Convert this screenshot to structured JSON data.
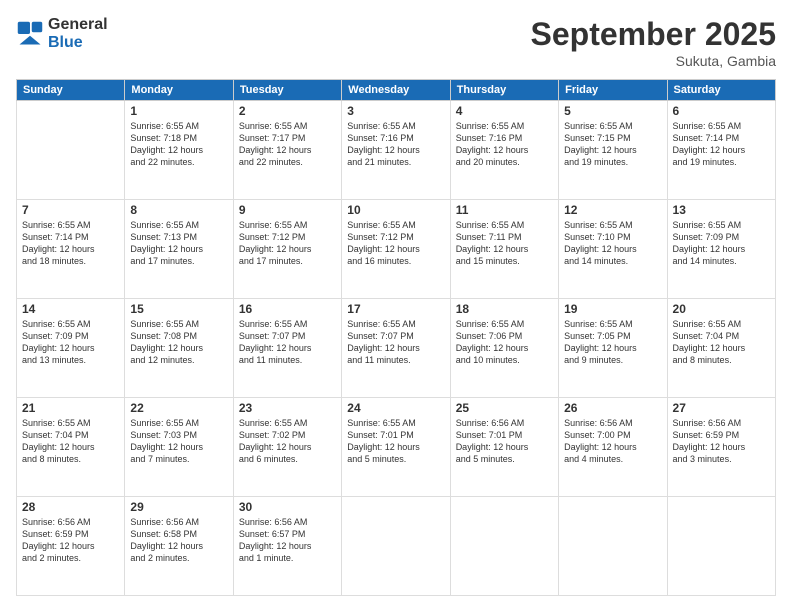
{
  "header": {
    "logo_line1": "General",
    "logo_line2": "Blue",
    "month": "September 2025",
    "location": "Sukuta, Gambia"
  },
  "days_of_week": [
    "Sunday",
    "Monday",
    "Tuesday",
    "Wednesday",
    "Thursday",
    "Friday",
    "Saturday"
  ],
  "weeks": [
    [
      {
        "day": "",
        "info": ""
      },
      {
        "day": "1",
        "info": "Sunrise: 6:55 AM\nSunset: 7:18 PM\nDaylight: 12 hours\nand 22 minutes."
      },
      {
        "day": "2",
        "info": "Sunrise: 6:55 AM\nSunset: 7:17 PM\nDaylight: 12 hours\nand 22 minutes."
      },
      {
        "day": "3",
        "info": "Sunrise: 6:55 AM\nSunset: 7:16 PM\nDaylight: 12 hours\nand 21 minutes."
      },
      {
        "day": "4",
        "info": "Sunrise: 6:55 AM\nSunset: 7:16 PM\nDaylight: 12 hours\nand 20 minutes."
      },
      {
        "day": "5",
        "info": "Sunrise: 6:55 AM\nSunset: 7:15 PM\nDaylight: 12 hours\nand 19 minutes."
      },
      {
        "day": "6",
        "info": "Sunrise: 6:55 AM\nSunset: 7:14 PM\nDaylight: 12 hours\nand 19 minutes."
      }
    ],
    [
      {
        "day": "7",
        "info": "Sunrise: 6:55 AM\nSunset: 7:14 PM\nDaylight: 12 hours\nand 18 minutes."
      },
      {
        "day": "8",
        "info": "Sunrise: 6:55 AM\nSunset: 7:13 PM\nDaylight: 12 hours\nand 17 minutes."
      },
      {
        "day": "9",
        "info": "Sunrise: 6:55 AM\nSunset: 7:12 PM\nDaylight: 12 hours\nand 17 minutes."
      },
      {
        "day": "10",
        "info": "Sunrise: 6:55 AM\nSunset: 7:12 PM\nDaylight: 12 hours\nand 16 minutes."
      },
      {
        "day": "11",
        "info": "Sunrise: 6:55 AM\nSunset: 7:11 PM\nDaylight: 12 hours\nand 15 minutes."
      },
      {
        "day": "12",
        "info": "Sunrise: 6:55 AM\nSunset: 7:10 PM\nDaylight: 12 hours\nand 14 minutes."
      },
      {
        "day": "13",
        "info": "Sunrise: 6:55 AM\nSunset: 7:09 PM\nDaylight: 12 hours\nand 14 minutes."
      }
    ],
    [
      {
        "day": "14",
        "info": "Sunrise: 6:55 AM\nSunset: 7:09 PM\nDaylight: 12 hours\nand 13 minutes."
      },
      {
        "day": "15",
        "info": "Sunrise: 6:55 AM\nSunset: 7:08 PM\nDaylight: 12 hours\nand 12 minutes."
      },
      {
        "day": "16",
        "info": "Sunrise: 6:55 AM\nSunset: 7:07 PM\nDaylight: 12 hours\nand 11 minutes."
      },
      {
        "day": "17",
        "info": "Sunrise: 6:55 AM\nSunset: 7:07 PM\nDaylight: 12 hours\nand 11 minutes."
      },
      {
        "day": "18",
        "info": "Sunrise: 6:55 AM\nSunset: 7:06 PM\nDaylight: 12 hours\nand 10 minutes."
      },
      {
        "day": "19",
        "info": "Sunrise: 6:55 AM\nSunset: 7:05 PM\nDaylight: 12 hours\nand 9 minutes."
      },
      {
        "day": "20",
        "info": "Sunrise: 6:55 AM\nSunset: 7:04 PM\nDaylight: 12 hours\nand 8 minutes."
      }
    ],
    [
      {
        "day": "21",
        "info": "Sunrise: 6:55 AM\nSunset: 7:04 PM\nDaylight: 12 hours\nand 8 minutes."
      },
      {
        "day": "22",
        "info": "Sunrise: 6:55 AM\nSunset: 7:03 PM\nDaylight: 12 hours\nand 7 minutes."
      },
      {
        "day": "23",
        "info": "Sunrise: 6:55 AM\nSunset: 7:02 PM\nDaylight: 12 hours\nand 6 minutes."
      },
      {
        "day": "24",
        "info": "Sunrise: 6:55 AM\nSunset: 7:01 PM\nDaylight: 12 hours\nand 5 minutes."
      },
      {
        "day": "25",
        "info": "Sunrise: 6:56 AM\nSunset: 7:01 PM\nDaylight: 12 hours\nand 5 minutes."
      },
      {
        "day": "26",
        "info": "Sunrise: 6:56 AM\nSunset: 7:00 PM\nDaylight: 12 hours\nand 4 minutes."
      },
      {
        "day": "27",
        "info": "Sunrise: 6:56 AM\nSunset: 6:59 PM\nDaylight: 12 hours\nand 3 minutes."
      }
    ],
    [
      {
        "day": "28",
        "info": "Sunrise: 6:56 AM\nSunset: 6:59 PM\nDaylight: 12 hours\nand 2 minutes."
      },
      {
        "day": "29",
        "info": "Sunrise: 6:56 AM\nSunset: 6:58 PM\nDaylight: 12 hours\nand 2 minutes."
      },
      {
        "day": "30",
        "info": "Sunrise: 6:56 AM\nSunset: 6:57 PM\nDaylight: 12 hours\nand 1 minute."
      },
      {
        "day": "",
        "info": ""
      },
      {
        "day": "",
        "info": ""
      },
      {
        "day": "",
        "info": ""
      },
      {
        "day": "",
        "info": ""
      }
    ]
  ]
}
